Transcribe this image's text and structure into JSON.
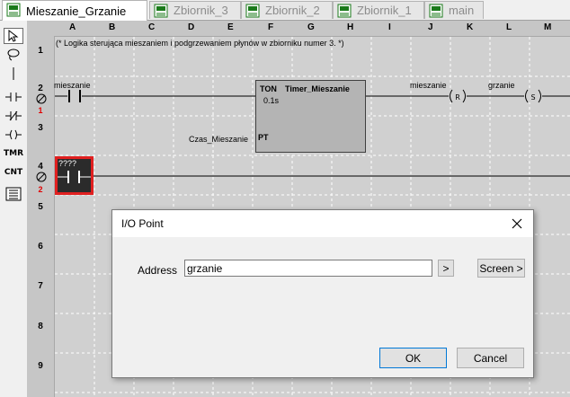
{
  "tabs": [
    {
      "label": "Mieszanie_Grzanie",
      "active": true
    },
    {
      "label": "Zbiornik_3",
      "active": false
    },
    {
      "label": "Zbiornik_2",
      "active": false
    },
    {
      "label": "Zbiornik_1",
      "active": false
    },
    {
      "label": "main",
      "active": false
    }
  ],
  "toolbar": {
    "tools": [
      "pointer-icon",
      "lasso-icon",
      "vertical-line-icon",
      "no-contact-icon",
      "nc-contact-icon",
      "coil-icon"
    ],
    "tmr_label": "TMR",
    "cnt_label": "CNT"
  },
  "ladder": {
    "columns": [
      "A",
      "B",
      "C",
      "D",
      "E",
      "F",
      "G",
      "H",
      "I",
      "J",
      "K",
      "L",
      "M"
    ],
    "rows": [
      "1",
      "2",
      "3",
      "4",
      "5",
      "6",
      "7",
      "8",
      "9"
    ],
    "rung_numbers": [
      "1",
      "2"
    ],
    "comment": "(* Logika sterująca mieszaniem i podgrzewaniem płynów w zbiorniku numer 3. *)",
    "contact_label": "mieszanie",
    "timer": {
      "type": "TON",
      "name": "Timer_Mieszanie",
      "base": "0.1s",
      "pt_pin": "PT"
    },
    "pt_label": "Czas_Mieszanie",
    "coil_reset_label": "mieszanie",
    "coil_reset_symbol": "R",
    "coil_set_label": "grzanie",
    "coil_set_symbol": "S",
    "new_contact_label": "????",
    "colors": {
      "selection": "#e02020",
      "rung_text": "#e00000",
      "timer_fill": "#b4b4b4"
    }
  },
  "dialog": {
    "title": "I/O Point",
    "address_label": "Address",
    "address_value": "grzanie",
    "arrow_button": ">",
    "screen_button": "Screen >",
    "ok_button": "OK",
    "cancel_button": "Cancel"
  }
}
